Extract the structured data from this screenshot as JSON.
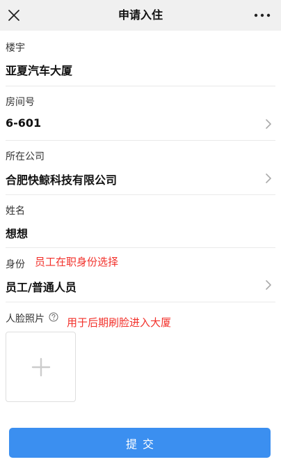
{
  "header": {
    "title": "申请入住"
  },
  "form": {
    "building": {
      "label": "楼宇",
      "value": "亚夏汽车大厦"
    },
    "room": {
      "label": "房间号",
      "value": "6-601"
    },
    "company": {
      "label": "所在公司",
      "value": "合肥快鲸科技有限公司"
    },
    "name": {
      "label": "姓名",
      "value": "想想"
    },
    "identity": {
      "label": "身份",
      "value": "员工/普通人员",
      "note": "员工在职身份选择"
    },
    "face_photo": {
      "label": "人脸照片",
      "note": "用于后期刷脸进入大厦"
    }
  },
  "submit_label": "提交",
  "colors": {
    "accent": "#3b8ff0",
    "annotation": "#f2302a",
    "topbar_bg": "#f0f0f0"
  },
  "icons": [
    "close-icon",
    "more-icon",
    "chevron-right-icon",
    "help-icon",
    "plus-icon"
  ]
}
